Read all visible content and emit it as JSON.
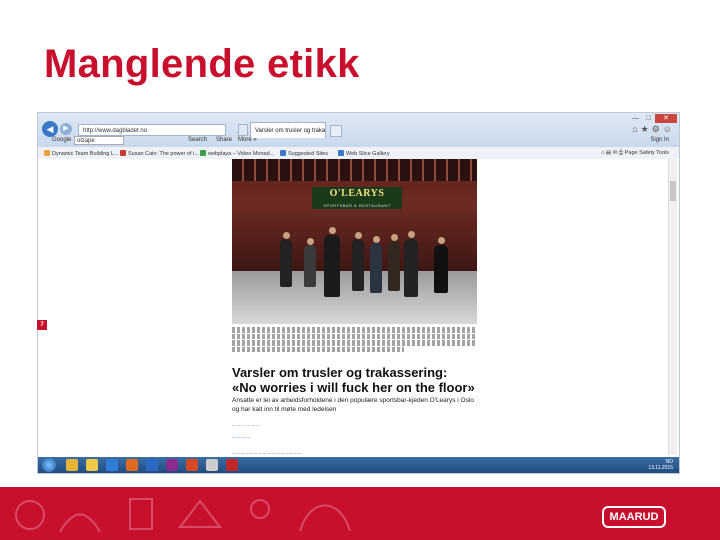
{
  "slide": {
    "title": "Manglende etikk"
  },
  "browser": {
    "url": "http://www.dagbladet.no",
    "tab_label": "Varsler om trusler og trakas...",
    "google_label": "Google",
    "google_query": "olzape",
    "search_label": "Search",
    "share_label": "Share",
    "more_label": "More »",
    "signin_label": "Sign In",
    "favorites": [
      "Dynamic Team Building L...",
      "Susan Cain: The power of i...",
      "webplaya – Video Monad...",
      "Suggested Sites",
      "Web Slice Gallery"
    ],
    "command_bar": [
      "Page",
      "Safety",
      "Tools"
    ]
  },
  "article": {
    "sign_text": "O'LEARYS",
    "sign_sub": "SPORTSBAR & RESTAURANT",
    "headline_line1": "Varsler om trusler og trakassering:",
    "headline_line2": "«No worries i will fuck her on the floor»",
    "lede": "Ansatte er lei av arbeidsforholdene i den populære sportsbar-kjeden O'Learys i Oslo og har kalt inn til møte med ledelsen"
  },
  "taskbar": {
    "lang": "NO",
    "date": "13.11.2015"
  },
  "marker_label": "7",
  "brand": {
    "logo": "MAARUD",
    "accent": "#c8102e"
  }
}
